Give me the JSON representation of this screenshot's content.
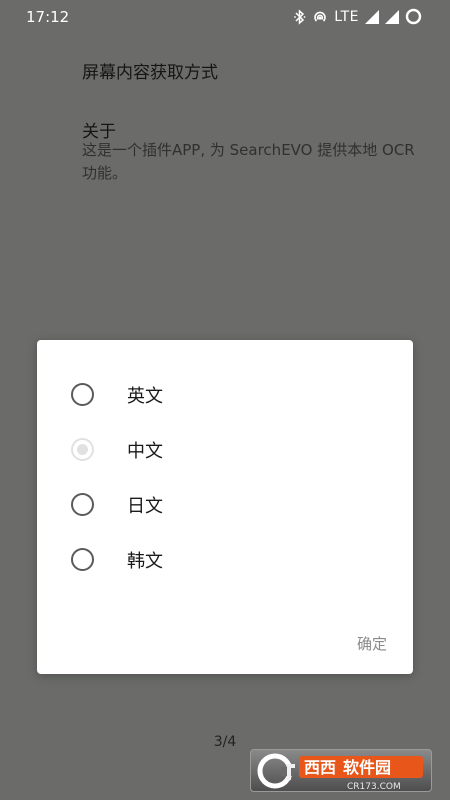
{
  "status_bar": {
    "time": "17:12",
    "network": "LTE",
    "icons": [
      "bluetooth-icon",
      "hotspot-icon",
      "signal-icon",
      "signal-icon",
      "battery-icon"
    ]
  },
  "background_page": {
    "setting_title": "屏幕内容获取方式",
    "about_title": "关于",
    "about_desc": "这是一个插件APP, 为 SearchEVO 提供本地 OCR 功能。",
    "page_indicator": "3/4"
  },
  "dialog": {
    "options": [
      {
        "label": "英文",
        "selected": false
      },
      {
        "label": "中文",
        "selected": true
      },
      {
        "label": "日文",
        "selected": false
      },
      {
        "label": "韩文",
        "selected": false
      }
    ],
    "confirm_label": "确定"
  },
  "watermark": {
    "text_main": "西西软件园",
    "text_sub": "CR173.COM"
  }
}
